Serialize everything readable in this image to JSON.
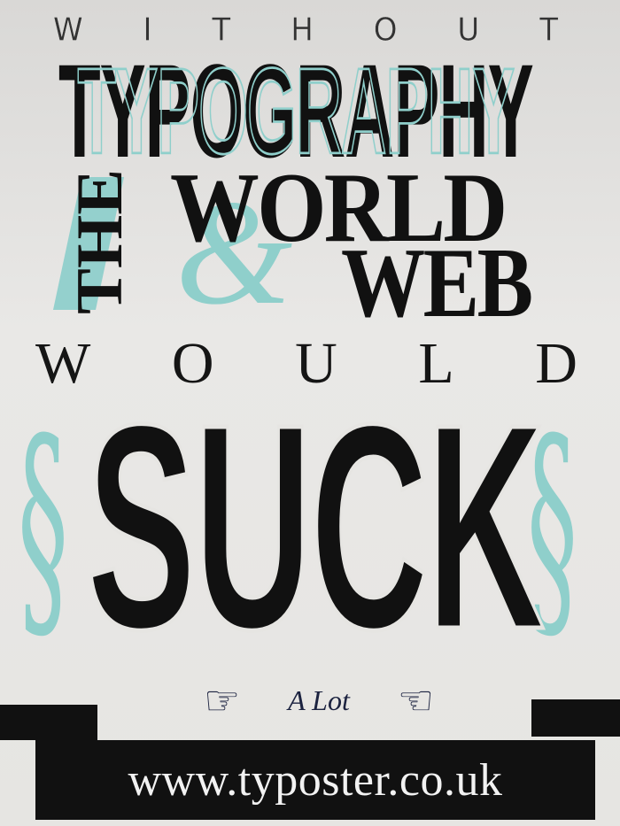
{
  "poster": {
    "line1": [
      "W",
      "I",
      "T",
      "H",
      "O",
      "U",
      "T"
    ],
    "line2": "TYPOGRAPHY",
    "line3_vertical": "THE",
    "line3_a": "WORLD",
    "ampersand": "&",
    "line3_b": "WEB",
    "line4": [
      "W",
      "O",
      "U",
      "L",
      "D"
    ],
    "line5": "SUCK",
    "tagline": "A Lot",
    "url": "www.typoster.co.uk"
  },
  "colors": {
    "accent": "#8fcfcb",
    "ink": "#111111",
    "paper": "#e6e5e2",
    "hands": "#1c2340"
  },
  "icons": {
    "left_hand": "pointing-hand-right-icon",
    "right_hand": "pointing-hand-left-icon",
    "scroll": "scroll-ornament-icon"
  }
}
